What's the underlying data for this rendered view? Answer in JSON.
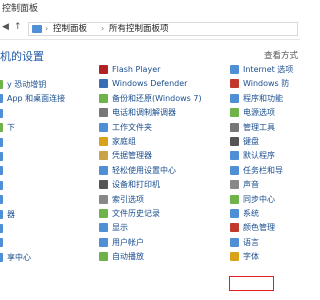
{
  "window": {
    "title": "控制面板"
  },
  "address": {
    "back_icon": "back-arrow-icon",
    "crumbs": [
      "控制面板",
      "所有控制面板项"
    ]
  },
  "header": {
    "title_partial": "机的设置",
    "view_by_partial": "查看方式"
  },
  "col1": [
    {
      "label": "y 恐动增钥",
      "color": "#6fb24a"
    },
    {
      "label": "App 和桌面连接",
      "color": "#4f8fd6"
    },
    {
      "label": "",
      "color": "#4f8fd6"
    },
    {
      "label": "下",
      "color": "#6fb24a"
    },
    {
      "label": "",
      "color": "#4f8fd6"
    },
    {
      "label": "",
      "color": "#4f8fd6"
    },
    {
      "label": "",
      "color": "#4f8fd6"
    },
    {
      "label": "",
      "color": "#4f8fd6"
    },
    {
      "label": "",
      "color": "#4f8fd6"
    },
    {
      "label": "器",
      "color": "#4f8fd6"
    },
    {
      "label": "",
      "color": "#4f8fd6"
    },
    {
      "label": "",
      "color": "#4f8fd6"
    },
    {
      "label": "享中心",
      "color": "#4f8fd6"
    }
  ],
  "col2": [
    {
      "label": "Flash Player",
      "color": "#b22222"
    },
    {
      "label": "Windows Defender",
      "color": "#3b6db5"
    },
    {
      "label": "备份和还原(Windows 7)",
      "color": "#6fb24a"
    },
    {
      "label": "电话和调制解调器",
      "color": "#777777"
    },
    {
      "label": "工作文件夹",
      "color": "#4f8fd6"
    },
    {
      "label": "家庭组",
      "color": "#d9a21b"
    },
    {
      "label": "凭据管理器",
      "color": "#c9a24a"
    },
    {
      "label": "轻松使用设置中心",
      "color": "#4f8fd6"
    },
    {
      "label": "设备和打印机",
      "color": "#555555"
    },
    {
      "label": "索引选项",
      "color": "#888888"
    },
    {
      "label": "文件历史记录",
      "color": "#6fb24a"
    },
    {
      "label": "显示",
      "color": "#4f8fd6"
    },
    {
      "label": "用户帐户",
      "color": "#4f8fd6"
    },
    {
      "label": "自动播放",
      "color": "#6fb24a"
    }
  ],
  "col3": [
    {
      "label": "Internet 选项",
      "color": "#4f8fd6"
    },
    {
      "label": "Windows 防",
      "color": "#c0392b"
    },
    {
      "label": "程序和功能",
      "color": "#4f8fd6"
    },
    {
      "label": "电源选项",
      "color": "#6fb24a"
    },
    {
      "label": "管理工具",
      "color": "#777777"
    },
    {
      "label": "键盘",
      "color": "#555555"
    },
    {
      "label": "默认程序",
      "color": "#4f8fd6"
    },
    {
      "label": "任务栏和导",
      "color": "#4f8fd6"
    },
    {
      "label": "声音",
      "color": "#888888"
    },
    {
      "label": "同步中心",
      "color": "#6fb24a"
    },
    {
      "label": "系统",
      "color": "#4f8fd6"
    },
    {
      "label": "颜色管理",
      "color": "#c0392b"
    },
    {
      "label": "语言",
      "color": "#4f8fd6"
    },
    {
      "label": "字体",
      "color": "#d9a21b"
    }
  ]
}
